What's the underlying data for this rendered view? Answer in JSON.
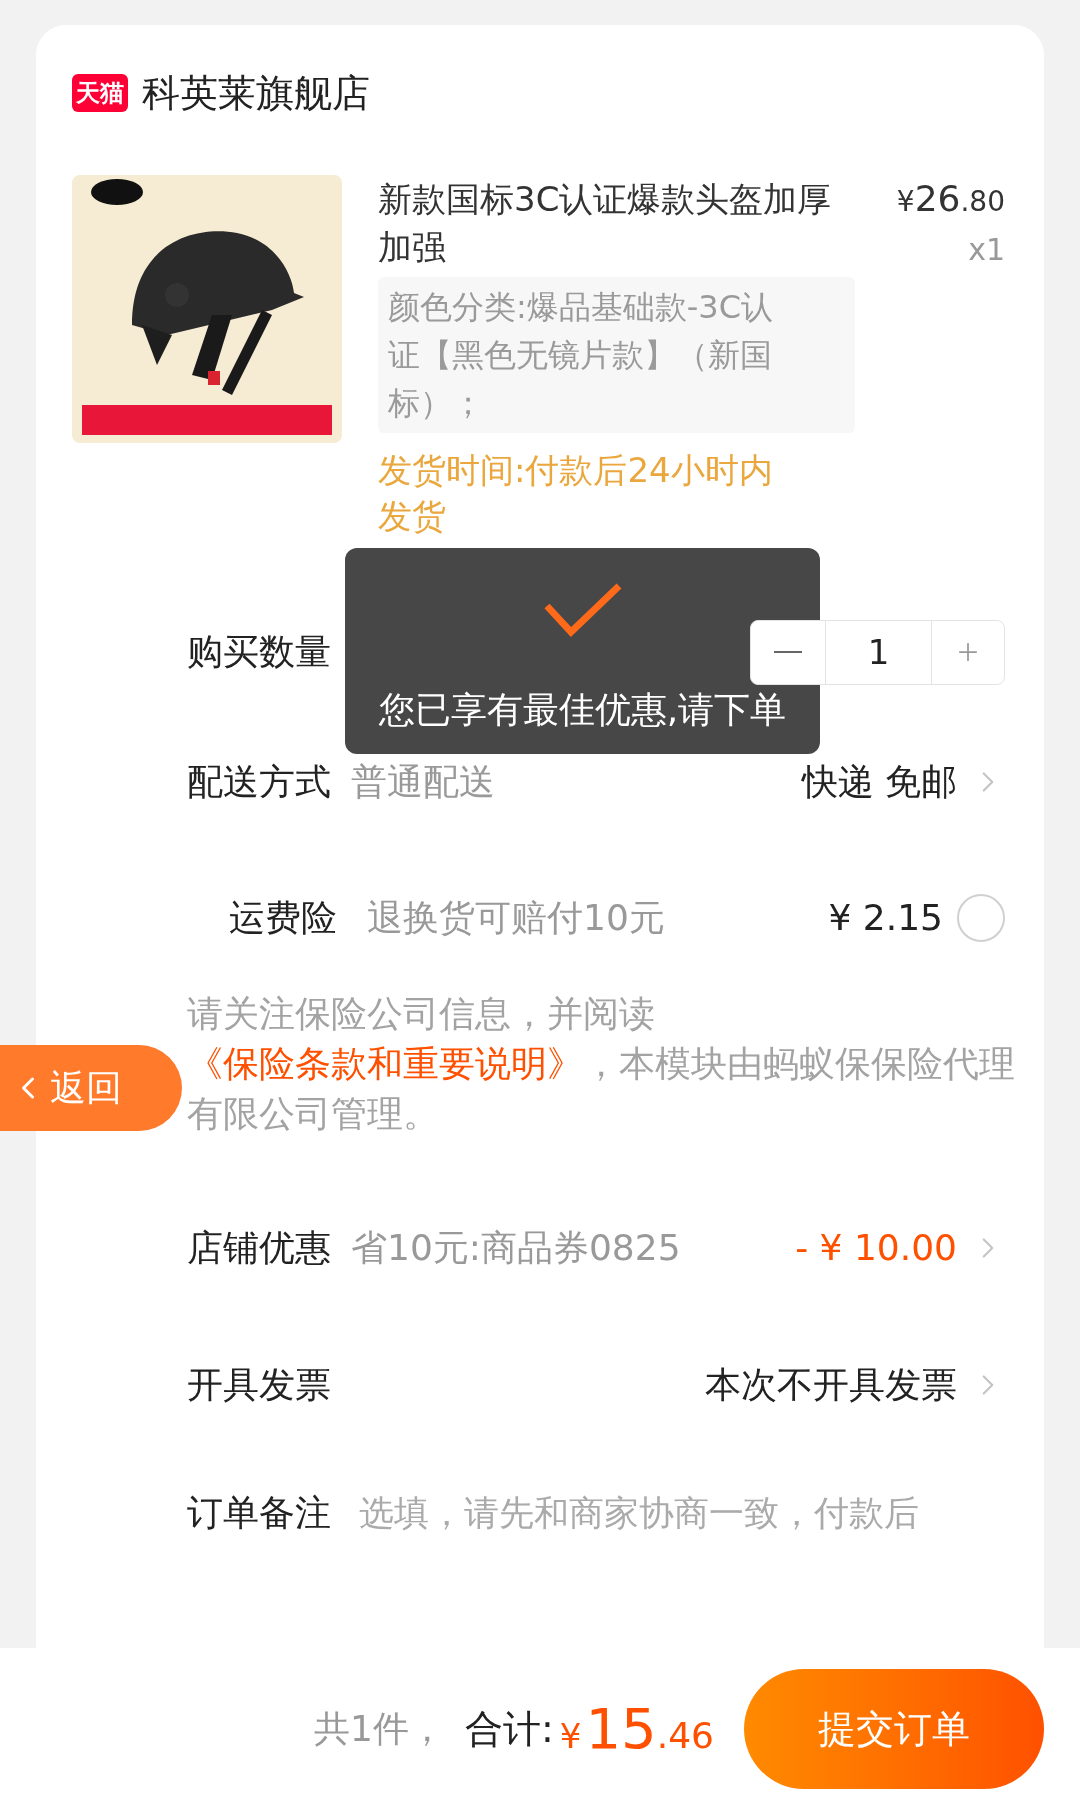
{
  "store": {
    "badge": "天猫",
    "name": "科英莱旗舰店"
  },
  "product": {
    "title": "新款国标3C认证爆款头盔加厚加强",
    "price_symbol": "¥",
    "price_int": "26",
    "price_dec": ".80",
    "quantity": "x1",
    "spec": "颜色分类:爆品基础款-3C认证【黑色无镜片款】（新国标）；",
    "shipping_time": "发货时间:付款后24小时内发货"
  },
  "quantity": {
    "label": "购买数量",
    "value": "1"
  },
  "delivery": {
    "label": "配送方式",
    "method": "普通配送",
    "value": "快递 免邮"
  },
  "insurance": {
    "label": "运费险",
    "description": "退换货可赔付10元",
    "price": "¥ 2.15",
    "checked": false,
    "notice_before": "请关注保险公司信息，并阅读",
    "notice_link": "《保险条款和重要说明》",
    "notice_after": "，本模块由蚂蚁保保险代理有限公司管理。"
  },
  "discount": {
    "label": "店铺优惠",
    "description": "省10元:商品券0825",
    "value": "- ¥ 10.00"
  },
  "invoice": {
    "label": "开具发票",
    "value": "本次不开具发票"
  },
  "note": {
    "label": "订单备注",
    "placeholder": "选填，请先和商家协商一致，付款后"
  },
  "footer": {
    "count": "共1件，",
    "total_label": "合计:",
    "currency": "¥",
    "total_int": "15",
    "total_dec": ".46",
    "submit": "提交订单"
  },
  "toast": {
    "message": "您已享有最佳优惠,请下单"
  },
  "back_button": {
    "label": "返回"
  }
}
